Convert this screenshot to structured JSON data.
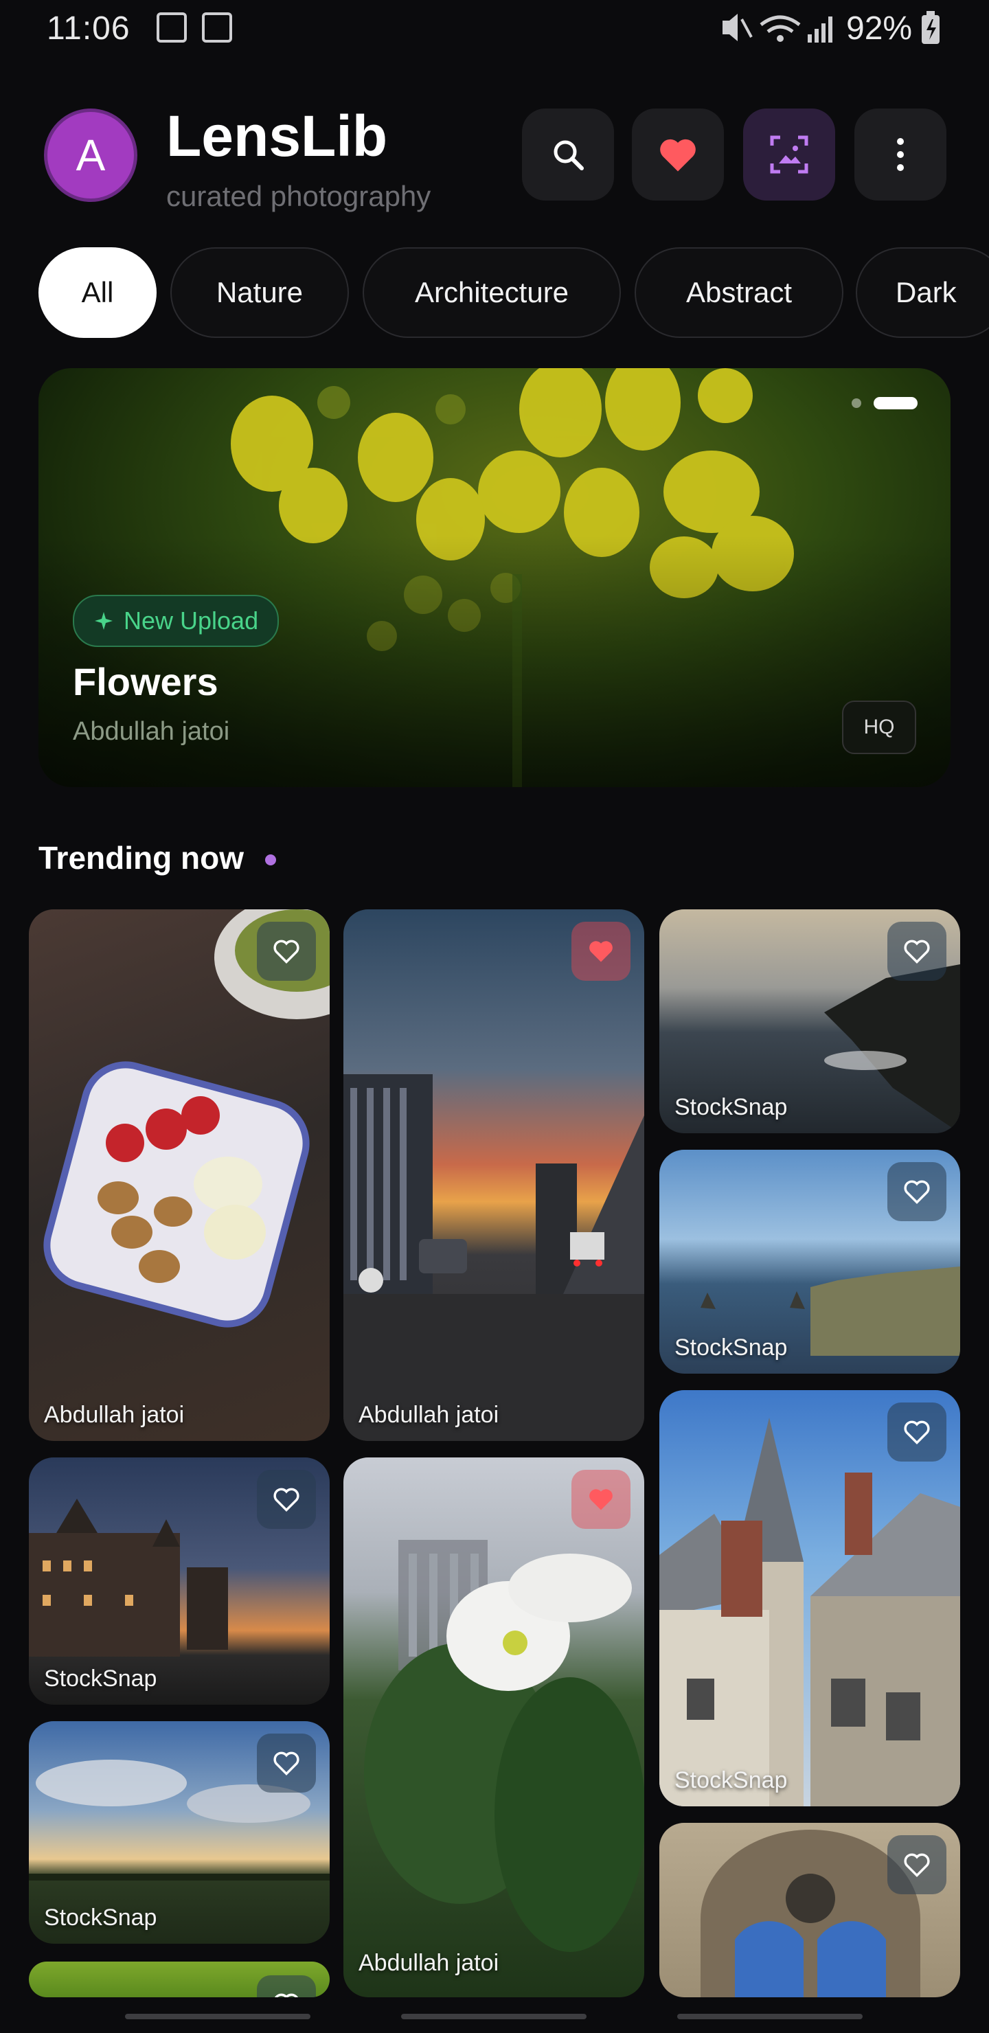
{
  "status_bar": {
    "time": "11:06",
    "battery": "92%"
  },
  "header": {
    "avatar_letter": "A",
    "title": "LensLib",
    "subtitle": "curated photography"
  },
  "chips": [
    "All",
    "Nature",
    "Architecture",
    "Abstract",
    "Dark"
  ],
  "featured": {
    "badge": "New Upload",
    "title": "Flowers",
    "author": "Abdullah jatoi",
    "quality": "HQ"
  },
  "section": {
    "title": "Trending now"
  },
  "cards": [
    {
      "caption": "Abdullah jatoi",
      "favorited": false
    },
    {
      "caption": "Abdullah jatoi",
      "favorited": true
    },
    {
      "caption": "StockSnap",
      "favorited": false
    },
    {
      "caption": "StockSnap",
      "favorited": false
    },
    {
      "caption": "StockSnap",
      "favorited": false
    },
    {
      "caption": "Abdullah jatoi",
      "favorited": true
    },
    {
      "caption": "StockSnap",
      "favorited": false
    },
    {
      "caption": "StockSnap",
      "favorited": false
    },
    {
      "caption": "",
      "favorited": false
    },
    {
      "caption": "",
      "favorited": false
    }
  ],
  "colors": {
    "accent": "#b071e0",
    "favorite": "#ff5a5f",
    "badge_green": "#49d48a"
  }
}
